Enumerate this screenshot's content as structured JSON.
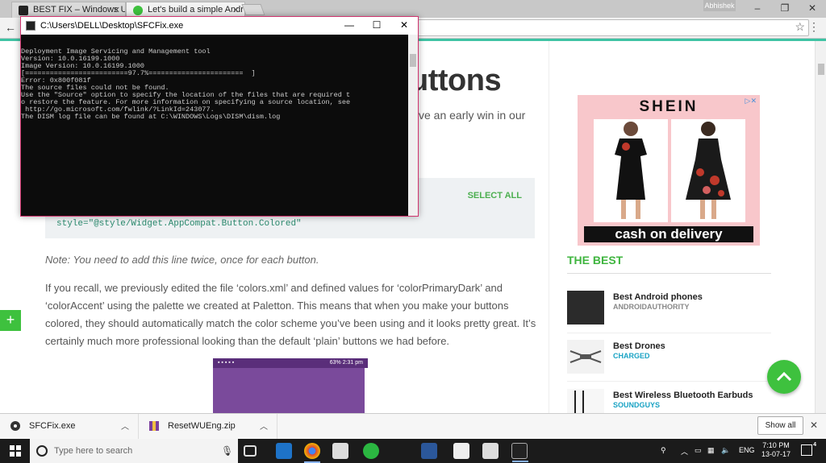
{
  "browser": {
    "tabs": [
      {
        "title": "BEST FIX – Windows Upd",
        "active": false
      },
      {
        "title": "Let's build a simple Andr",
        "active": true
      }
    ],
    "user_badge": "Abhishek",
    "window_controls": [
      "–",
      "❐",
      "✕"
    ]
  },
  "console": {
    "title": "C:\\Users\\DELL\\Desktop\\SFCFix.exe",
    "lines": [
      "Deployment Image Servicing and Management tool",
      "Version: 10.0.16199.1000",
      "",
      "Image Version: 10.0.16199.1000",
      "",
      "[=========================97.7%=======================  ]",
      "Error: 0x800f081f",
      "",
      "The source files could not be found.",
      "Use the \"Source\" option to specify the location of the files that are required t",
      "o restore the feature. For more information on specifying a source location, see",
      " http://go.microsoft.com/fwlink/?LinkId=243077.",
      "",
      "The DISM log file can be found at C:\\WINDOWS\\Logs\\DISM\\dism.log"
    ]
  },
  "article": {
    "title_fragment": "uttons",
    "sub_fragment": "ve an early win in our",
    "select_all": "SELECT ALL",
    "code_line": "style=\"@style/Widget.AppCompat.Button.Colored\"",
    "note": "Note: You need to add this line twice, once for each button.",
    "paragraph": "If you recall, we previously edited the file ‘colors.xml’ and defined values for ‘colorPrimaryDark’ and ‘colorAccent’ using the palette we created at Paletton. This means that when you make your buttons colored, they should automatically match the color scheme you’ve been using and it looks pretty great. It’s certainly much more professional looking than the default ‘plain’ buttons we had before.",
    "phone_status": "63% 2:31 pm"
  },
  "ad": {
    "brand": "SHEIN",
    "tagline": "cash on delivery"
  },
  "sidebar": {
    "heading": "THE BEST",
    "items": [
      {
        "title": "Best Android phones",
        "source": "ANDROIDAUTHORITY"
      },
      {
        "title": "Best Drones",
        "source": "CHARGED"
      },
      {
        "title": "Best Wireless Bluetooth Earbuds",
        "source": "SOUNDGUYS"
      }
    ]
  },
  "downloads": {
    "items": [
      {
        "name": "SFCFix.exe"
      },
      {
        "name": "ResetWUEng.zip"
      }
    ],
    "show_all": "Show all"
  },
  "taskbar": {
    "search_placeholder": "Type here to search",
    "language": "ENG",
    "time": "7:10 PM",
    "date": "13-07-17",
    "mail_badge": "4",
    "notif_badge": "4"
  },
  "colors": {
    "accent_green": "#3ec13e",
    "console_border": "#d0346e",
    "progress_teal": "#3ec3a4"
  }
}
